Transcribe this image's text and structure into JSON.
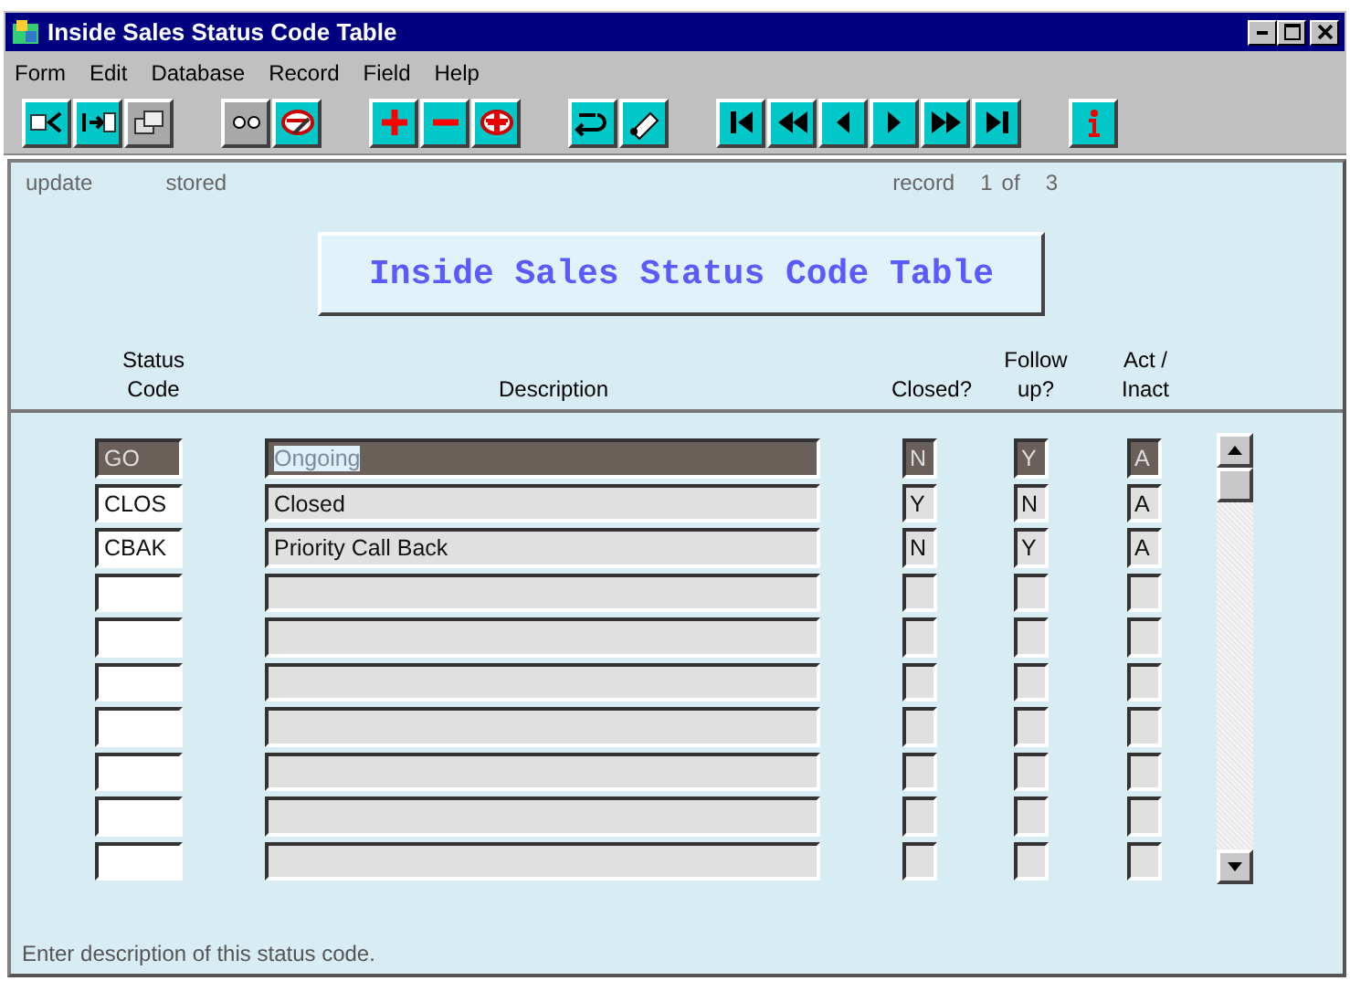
{
  "window": {
    "title": "Inside Sales Status Code Table"
  },
  "menu": [
    {
      "label": "Form"
    },
    {
      "label": "Edit"
    },
    {
      "label": "Database"
    },
    {
      "label": "Record"
    },
    {
      "label": "Field"
    },
    {
      "label": "Help"
    }
  ],
  "toolbar": [
    [
      {
        "kind": "enter-query",
        "disabled": false
      },
      {
        "kind": "execute-query",
        "disabled": false
      },
      {
        "kind": "count",
        "disabled": true
      }
    ],
    [
      {
        "kind": "view",
        "disabled": true
      },
      {
        "kind": "erase",
        "disabled": false
      }
    ],
    [
      {
        "kind": "insert",
        "disabled": false
      },
      {
        "kind": "delete",
        "disabled": false
      },
      {
        "kind": "duplicate",
        "disabled": false
      }
    ],
    [
      {
        "kind": "undo",
        "disabled": false
      },
      {
        "kind": "edit",
        "disabled": false
      }
    ],
    [
      {
        "kind": "first",
        "disabled": false
      },
      {
        "kind": "prev-set",
        "disabled": false
      },
      {
        "kind": "prev",
        "disabled": false
      },
      {
        "kind": "next",
        "disabled": false
      },
      {
        "kind": "next-set",
        "disabled": false
      },
      {
        "kind": "last",
        "disabled": false
      }
    ],
    [
      {
        "kind": "info",
        "disabled": false
      }
    ]
  ],
  "status": {
    "mode": "update",
    "state": "stored",
    "record_label": "record",
    "record": "1",
    "of": "of",
    "total": "3"
  },
  "form_title": "Inside Sales Status Code Table",
  "columns": {
    "code": [
      "Status",
      "Code"
    ],
    "description": [
      "Description"
    ],
    "closed": [
      "Closed?"
    ],
    "follow_up": [
      "Follow",
      "up?"
    ],
    "active": [
      "Act /",
      "Inact"
    ]
  },
  "rows": [
    {
      "code": "GO",
      "description": "Ongoing",
      "closed": "N",
      "follow_up": "Y",
      "active": "A",
      "selected": true
    },
    {
      "code": "CLOS",
      "description": "Closed",
      "closed": "Y",
      "follow_up": "N",
      "active": "A",
      "selected": false
    },
    {
      "code": "CBAK",
      "description": "Priority Call Back",
      "closed": "N",
      "follow_up": "Y",
      "active": "A",
      "selected": false
    },
    {
      "selected": false
    },
    {
      "selected": false
    },
    {
      "selected": false
    },
    {
      "selected": false
    },
    {
      "selected": false
    },
    {
      "selected": false
    },
    {
      "selected": false
    }
  ],
  "hint": "Enter description of this status code."
}
